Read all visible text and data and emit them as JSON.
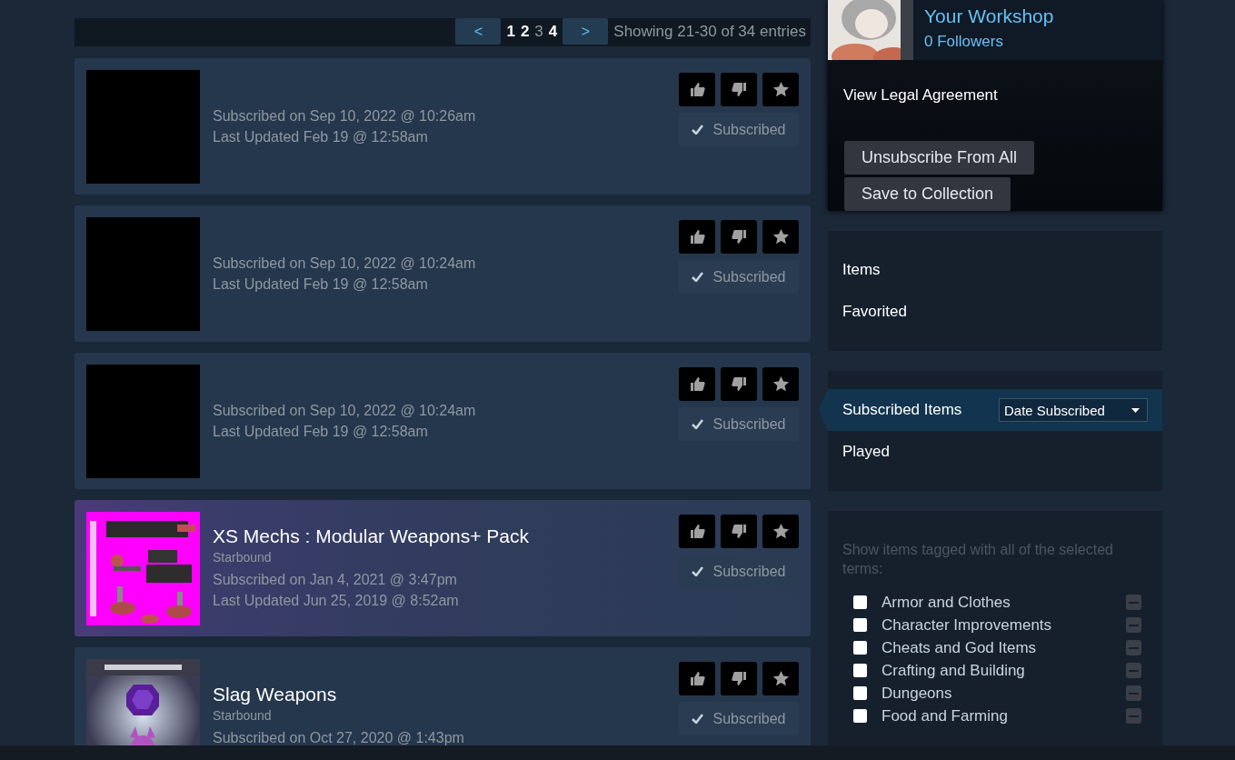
{
  "pagination": {
    "prev": "<",
    "next": ">",
    "pages": [
      {
        "label": "1",
        "selected": false
      },
      {
        "label": "2",
        "selected": false
      },
      {
        "label": "3",
        "selected": true
      },
      {
        "label": "4",
        "selected": false
      }
    ],
    "summary": "Showing 21-30 of 34 entries"
  },
  "items": [
    {
      "kind": "blank",
      "hovered": false,
      "subscribed": "Subscribed on Sep 10, 2022 @ 10:26am",
      "updated": "Last Updated Feb 19 @ 12:58am",
      "button": "Subscribed"
    },
    {
      "kind": "blank",
      "hovered": false,
      "subscribed": "Subscribed on Sep 10, 2022 @ 10:24am",
      "updated": "Last Updated Feb 19 @ 12:58am",
      "button": "Subscribed"
    },
    {
      "kind": "blank",
      "hovered": false,
      "subscribed": "Subscribed on Sep 10, 2022 @ 10:24am",
      "updated": "Last Updated Feb 19 @ 12:58am",
      "button": "Subscribed"
    },
    {
      "kind": "picture",
      "hovered": true,
      "title": "XS Mechs : Modular Weapons+ Pack",
      "game": "Starbound",
      "subscribed": "Subscribed on Jan 4, 2021 @ 3:47pm",
      "updated": "Last Updated Jun 25, 2019 @ 8:52am",
      "button": "Subscribed"
    },
    {
      "kind": "picture",
      "hovered": false,
      "title": "Slag Weapons",
      "game": "Starbound",
      "subscribed": "Subscribed on Oct 27, 2020 @ 1:43pm",
      "button": "Subscribed"
    }
  ],
  "profile": {
    "title": "Your Workshop",
    "followers": "0 Followers",
    "legal_link": "View Legal Agreement",
    "buttons": [
      "Unsubscribe From All",
      "Save to Collection"
    ]
  },
  "filters": [
    {
      "label": "Items",
      "selected": false
    },
    {
      "label": "Favorited",
      "selected": false
    }
  ],
  "filters_2": [
    {
      "label": "Subscribed Items",
      "selected": true,
      "sort": "Date Subscribed"
    },
    {
      "label": "Played",
      "selected": false
    }
  ],
  "tags": {
    "intro": "Show items tagged with all of the selected terms:",
    "options": [
      {
        "label": "Armor and Clothes",
        "checked": false
      },
      {
        "label": "Character Improvements",
        "checked": false
      },
      {
        "label": "Cheats and God Items",
        "checked": false
      },
      {
        "label": "Crafting and Building",
        "checked": false
      },
      {
        "label": "Dungeons",
        "checked": false
      },
      {
        "label": "Food and Farming",
        "checked": false
      }
    ]
  }
}
